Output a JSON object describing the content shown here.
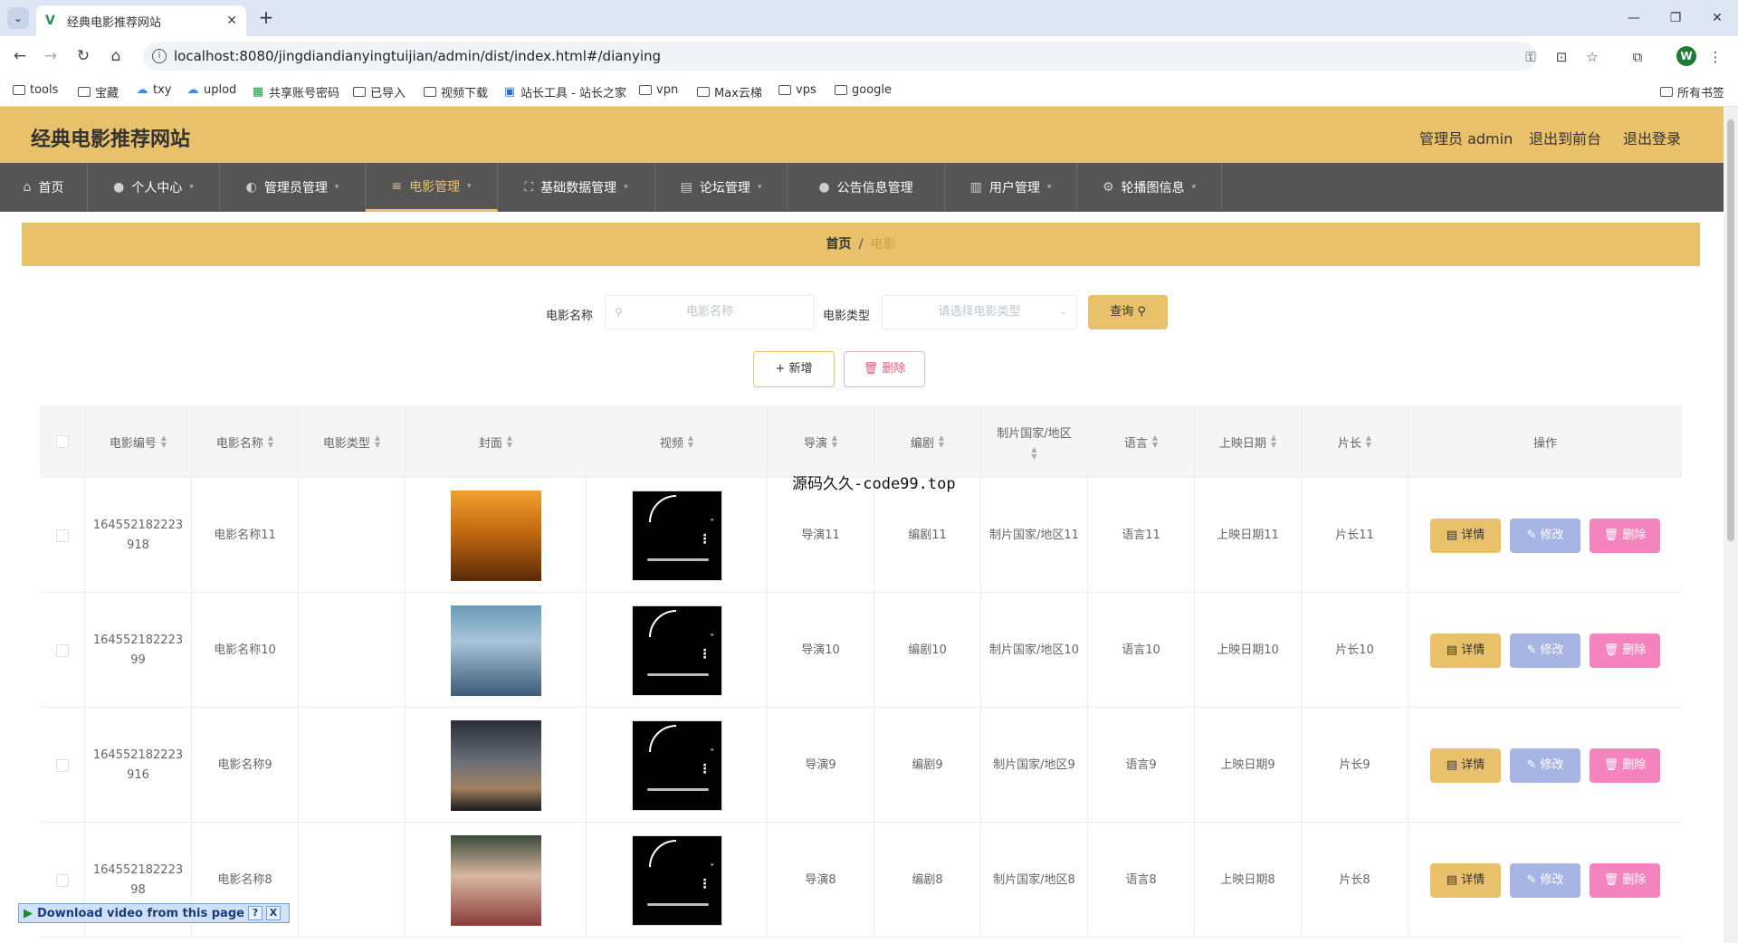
{
  "browser": {
    "tab_title": "经典电影推荐网站",
    "url": "localhost:8080/jingdiandianyingtuijian/admin/dist/index.html#/dianying",
    "bookmarks": [
      "tools",
      "宝藏",
      "txy",
      "uplod",
      "共享账号密码",
      "已导入",
      "视频下载",
      "站长工具 - 站长之家",
      "vpn",
      "Max云梯",
      "vps",
      "google"
    ],
    "all_bookmarks": "所有书签",
    "profile_initial": "W"
  },
  "app": {
    "title": "经典电影推荐网站",
    "admin_label": "管理员 admin",
    "to_front": "退出到前台",
    "logout": "退出登录"
  },
  "nav": {
    "items": [
      "首页",
      "个人中心",
      "管理员管理",
      "电影管理",
      "基础数据管理",
      "论坛管理",
      "公告信息管理",
      "用户管理",
      "轮播图信息"
    ]
  },
  "breadcrumb": {
    "home": "首页",
    "sep": "/",
    "current": "电影"
  },
  "search": {
    "name_label": "电影名称",
    "name_placeholder": "电影名称",
    "type_label": "电影类型",
    "type_placeholder": "请选择电影类型",
    "query_label": "查询"
  },
  "actions": {
    "add": "新增",
    "delete": "删除"
  },
  "table": {
    "headers": [
      "电影编号",
      "电影名称",
      "电影类型",
      "封面",
      "视频",
      "导演",
      "编剧",
      "制片国家/地区",
      "语言",
      "上映日期",
      "片长",
      "操作"
    ],
    "rows": [
      {
        "id": "164552182223918",
        "name": "电影名称11",
        "type": "",
        "director": "导演11",
        "writer": "编剧11",
        "country": "制片国家/地区11",
        "language": "语言11",
        "date": "上映日期11",
        "length": "片长11"
      },
      {
        "id": "16455218222399",
        "name": "电影名称10",
        "type": "",
        "director": "导演10",
        "writer": "编剧10",
        "country": "制片国家/地区10",
        "language": "语言10",
        "date": "上映日期10",
        "length": "片长10"
      },
      {
        "id": "164552182223916",
        "name": "电影名称9",
        "type": "",
        "director": "导演9",
        "writer": "编剧9",
        "country": "制片国家/地区9",
        "language": "语言9",
        "date": "上映日期9",
        "length": "片长9"
      },
      {
        "id": "16455218222398",
        "name": "电影名称8",
        "type": "",
        "director": "导演8",
        "writer": "编剧8",
        "country": "制片国家/地区8",
        "language": "语言8",
        "date": "上映日期8",
        "length": "片长8"
      }
    ],
    "op_detail": "详情",
    "op_edit": "修改",
    "op_delete": "删除"
  },
  "overlay_text": "源码久久-code99.top",
  "download_bar": {
    "label": "Download video from this page",
    "help": "?",
    "close": "X"
  },
  "colors": {
    "accent": "#e8c16a",
    "nav_bg": "#555555",
    "edit": "#a8b4e4",
    "danger": "#f584be"
  }
}
